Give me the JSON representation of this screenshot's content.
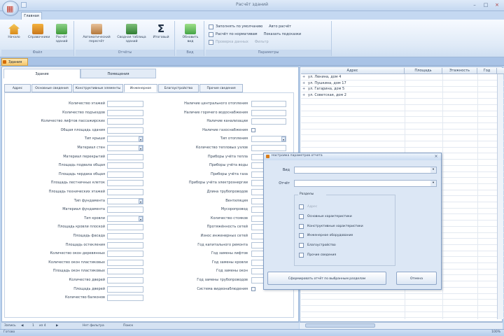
{
  "window": {
    "title": "Расчёт зданий"
  },
  "ribbon": {
    "tab": "Главная",
    "groups": [
      {
        "label": "Файл",
        "buttons": [
          "Начало",
          "Справочники",
          "Расчёт зданий"
        ]
      },
      {
        "label": "Отчёты",
        "buttons": [
          "Автоматический пересчёт",
          "Сводная таблица зданий",
          "Итоговый"
        ]
      },
      {
        "label": "Вид",
        "buttons": [
          "Обновить вид"
        ]
      }
    ],
    "options": [
      {
        "label": "Заполнять по умолчанию",
        "extra": "Авто расчёт",
        "checked": true,
        "dim": false
      },
      {
        "label": "Расчёт по нормативам",
        "extra": "Показать подсказки",
        "checked": true,
        "dim": false
      },
      {
        "label": "Проверка данных",
        "extra": "Фильтр",
        "checked": false,
        "dim": true
      }
    ],
    "options_group_label": "Параметры"
  },
  "doc_tab": "Здания",
  "panel_tabs": [
    "Здание",
    "Помещения"
  ],
  "sub_tabs": [
    {
      "label": "Адрес",
      "active": false
    },
    {
      "label": "Основные сведения",
      "active": false
    },
    {
      "label": "Конструктивные элементы",
      "active": false
    },
    {
      "label": "Инженерное",
      "active": true
    },
    {
      "label": "Благоустройство",
      "active": false
    },
    {
      "label": "Прочие сведения",
      "active": false
    }
  ],
  "form_left": [
    {
      "label": "Количество этажей",
      "kind": "input"
    },
    {
      "label": "Количество подъездов",
      "kind": "input"
    },
    {
      "label": "Количество лифтов пассажирских",
      "kind": "input"
    },
    {
      "label": "Общая площадь здания",
      "kind": "input"
    },
    {
      "label": "Тип крыши",
      "kind": "select"
    },
    {
      "label": "Материал стен",
      "kind": "select"
    },
    {
      "label": "Материал перекрытий",
      "kind": "input"
    },
    {
      "label": "Площадь подвала общая",
      "kind": "input"
    },
    {
      "label": "Площадь чердака общая",
      "kind": "input"
    },
    {
      "label": "Площадь лестничных клеток",
      "kind": "input"
    },
    {
      "label": "Площадь технических этажей",
      "kind": "input"
    },
    {
      "label": "Тип фундамента",
      "kind": "select"
    },
    {
      "label": "Материал фундамента",
      "kind": "input"
    },
    {
      "label": "Тип кровли",
      "kind": "select"
    },
    {
      "label": "Площадь кровли плоской",
      "kind": "input"
    },
    {
      "label": "Площадь фасада",
      "kind": "input"
    },
    {
      "label": "Площадь остекления",
      "kind": "input"
    },
    {
      "label": "Количество окон деревянных",
      "kind": "input"
    },
    {
      "label": "Количество окон пластиковых",
      "kind": "input"
    },
    {
      "label": "Площадь окон пластиковых",
      "kind": "input"
    },
    {
      "label": "Количество дверей",
      "kind": "input"
    },
    {
      "label": "Площадь дверей",
      "kind": "input"
    },
    {
      "label": "Количество балконов",
      "kind": "input"
    }
  ],
  "form_right": [
    {
      "label": "Наличие центрального отопления",
      "kind": "input"
    },
    {
      "label": "Наличие горячего водоснабжения",
      "kind": "input"
    },
    {
      "label": "Наличие канализации",
      "kind": "input"
    },
    {
      "label": "Наличие газоснабжения",
      "kind": "check"
    },
    {
      "label": "Тип отопления",
      "kind": "select"
    },
    {
      "label": "Количество тепловых узлов",
      "kind": "input"
    },
    {
      "label": "Приборы учёта тепла",
      "kind": "input"
    },
    {
      "label": "Приборы учёта воды",
      "kind": "input"
    },
    {
      "label": "Приборы учёта газа",
      "kind": "input"
    },
    {
      "label": "Приборы учёта электроэнергии",
      "kind": "input"
    },
    {
      "label": "Длина трубопроводов",
      "kind": "input"
    },
    {
      "label": "Вентиляция",
      "kind": "input"
    },
    {
      "label": "Мусоропровод",
      "kind": "input"
    },
    {
      "label": "Количество стояков",
      "kind": "input"
    },
    {
      "label": "Протяжённость сетей",
      "kind": "input"
    },
    {
      "label": "Износ инженерных сетей",
      "kind": "input"
    },
    {
      "label": "Год капитального ремонта",
      "kind": "input"
    },
    {
      "label": "Год замены лифтов",
      "kind": "input"
    },
    {
      "label": "Год замены кровли",
      "kind": "input"
    },
    {
      "label": "Год замены окон",
      "kind": "input"
    },
    {
      "label": "Год замены трубопроводов",
      "kind": "input"
    },
    {
      "label": "Система видеонаблюдения",
      "kind": "check"
    }
  ],
  "grid": {
    "columns": [
      "Адрес",
      "Площадь",
      "Этажность",
      "Год"
    ],
    "rows": [
      "ул. Ленина, дом 4",
      "ул. Пушкина, дом 17",
      "ул. Гагарина, дом 5",
      "ул. Советская, дом 2"
    ]
  },
  "dialog": {
    "title": "Настройка параметров отчёта",
    "fields": [
      {
        "label": "Вид",
        "value": ""
      },
      {
        "label": "Отчёт",
        "value": ""
      }
    ],
    "group_title": "Разделы",
    "items": [
      {
        "label": "Адрес",
        "checked": false,
        "dim": true
      },
      {
        "label": "Основные характеристики",
        "checked": false,
        "dim": false
      },
      {
        "label": "Конструктивные характеристики",
        "checked": false,
        "dim": false
      },
      {
        "label": "Инженерное оборудование",
        "checked": false,
        "dim": false
      },
      {
        "label": "Благоустройство",
        "checked": false,
        "dim": false
      },
      {
        "label": "Прочие сведения",
        "checked": false,
        "dim": false
      }
    ],
    "primary_button": "Сформировать отчёт по выбранным разделам",
    "cancel_button": "Отмена"
  },
  "nav": {
    "record": "Запись",
    "index": "1",
    "of": "из 4",
    "filter": "Нет фильтра",
    "search": "Поиск"
  },
  "status": {
    "text": "Готово",
    "zoom": "100%"
  }
}
